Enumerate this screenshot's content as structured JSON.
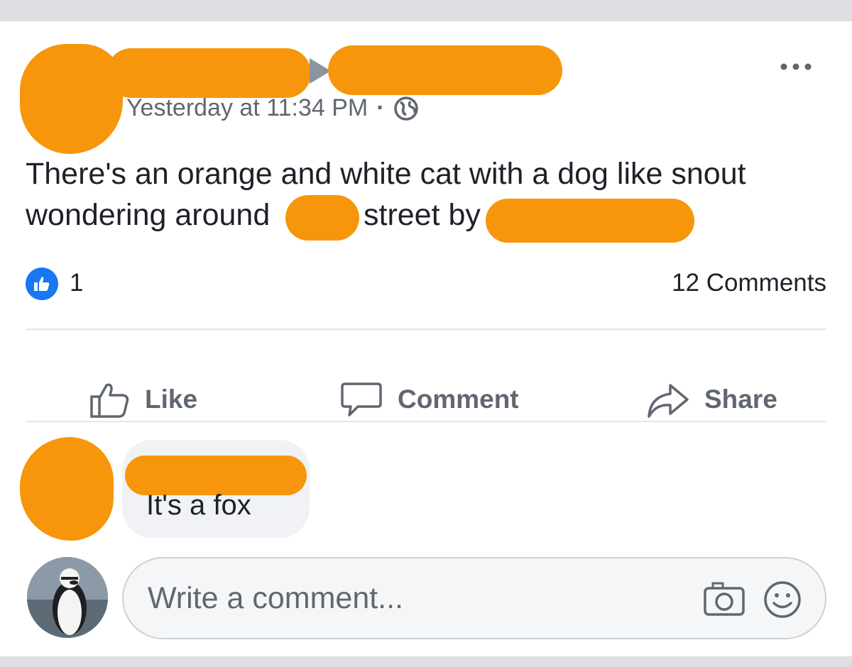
{
  "post": {
    "timestamp": "Yesterday at 11:34 PM",
    "separator": "·",
    "privacy_icon": "globe-icon",
    "text_part1": "There's an orange and white cat with a dog like snout",
    "text_part2a": "wondering around",
    "text_part2b": "street by",
    "more_icon": "more-options-icon"
  },
  "stats": {
    "like_count": "1",
    "comments": "12 Comments",
    "like_badge_color": "#1877f2"
  },
  "actions": {
    "like": "Like",
    "comment": "Comment",
    "share": "Share"
  },
  "comment": {
    "text": "It's a fox"
  },
  "composer": {
    "placeholder": "Write a comment...",
    "camera_icon": "camera-icon",
    "emoji_icon": "emoji-icon"
  },
  "colors": {
    "redaction": "#f7960a",
    "secondary_text": "#606770"
  }
}
